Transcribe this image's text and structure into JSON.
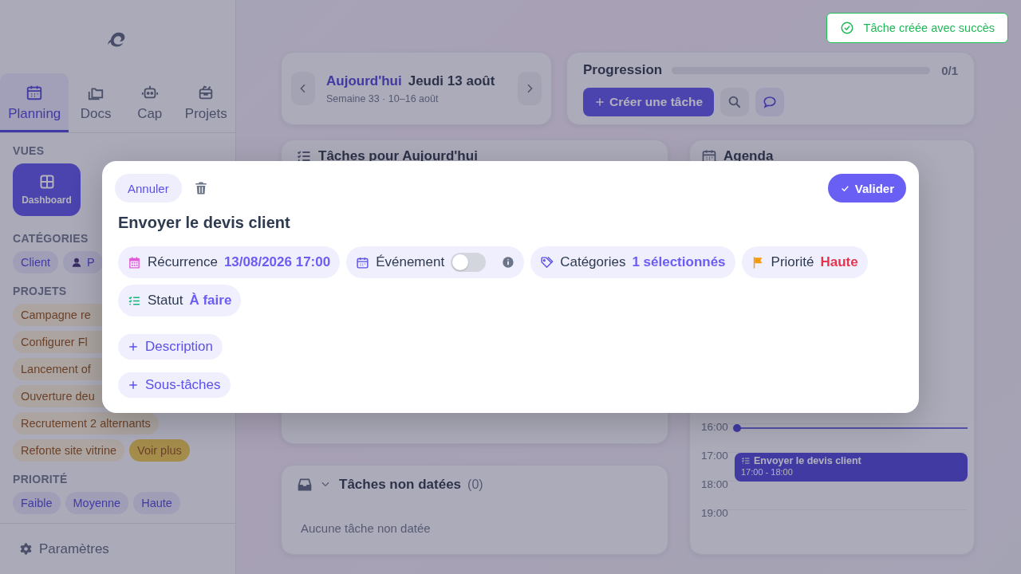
{
  "toast": {
    "text": "Tâche créée avec succès"
  },
  "sidebar": {
    "tabs": [
      {
        "label": "Planning",
        "selected": true
      },
      {
        "label": "Docs",
        "selected": false
      },
      {
        "label": "Cap",
        "selected": false
      },
      {
        "label": "Projets",
        "selected": false
      }
    ],
    "views_title": "VUES",
    "views": [
      {
        "label": "Dashboard",
        "selected": true
      }
    ],
    "categories_title": "CATÉGORIES",
    "categories": [
      "Client",
      "P"
    ],
    "projects_title": "PROJETS",
    "projects": [
      "Campagne re",
      "Configurer Fl",
      "Lancement of",
      "Ouverture deu",
      "Recrutement 2 alternants",
      "Refonte site vitrine"
    ],
    "more": "Voir plus",
    "priority_title": "PRIORITÉ",
    "priorities": [
      "Faible",
      "Moyenne",
      "Haute"
    ],
    "settings": "Paramètres"
  },
  "date_card": {
    "today": "Aujourd'hui",
    "date": "Jeudi 13 août",
    "week": "Semaine 33 · 10–16 août"
  },
  "progress_card": {
    "title": "Progression",
    "level": 0,
    "count": "0/1",
    "create": "Créer une tâche"
  },
  "tasks_card": {
    "title": "Tâches pour Aujourd'hui"
  },
  "unscheduled_card": {
    "title": "Tâches non datées",
    "count": "(0)",
    "empty": "Aucune tâche non datée"
  },
  "agenda": {
    "title": "Agenda",
    "hours": [
      {
        "label": "16:00",
        "now": true
      },
      {
        "label": "17:00",
        "now": false,
        "events": [
          {
            "title": "Envoyer le devis client",
            "time": "17:00 - 18:00"
          }
        ]
      },
      {
        "label": "18:00",
        "now": false
      },
      {
        "label": "19:00",
        "now": false
      }
    ]
  },
  "modal": {
    "cancel": "Annuler",
    "validate": "Valider",
    "title": "Envoyer le devis client",
    "fields": [
      {
        "kind": "value",
        "label": "Récurrence",
        "value": "13/08/2026 17:00",
        "color": "#6b5cf6"
      },
      {
        "kind": "toggle",
        "label": "Événement",
        "on": false
      },
      {
        "kind": "value",
        "label": "Catégories",
        "value": "1 sélectionnés",
        "color": "#6b5cf6"
      },
      {
        "kind": "value",
        "label": "Priorité",
        "value": "Haute",
        "color": "#e5354f"
      },
      {
        "kind": "value",
        "label": "Statut",
        "value": "À faire",
        "color": "#6b5cf6"
      }
    ],
    "add_buttons": [
      "Description",
      "Sous-tâches"
    ]
  }
}
